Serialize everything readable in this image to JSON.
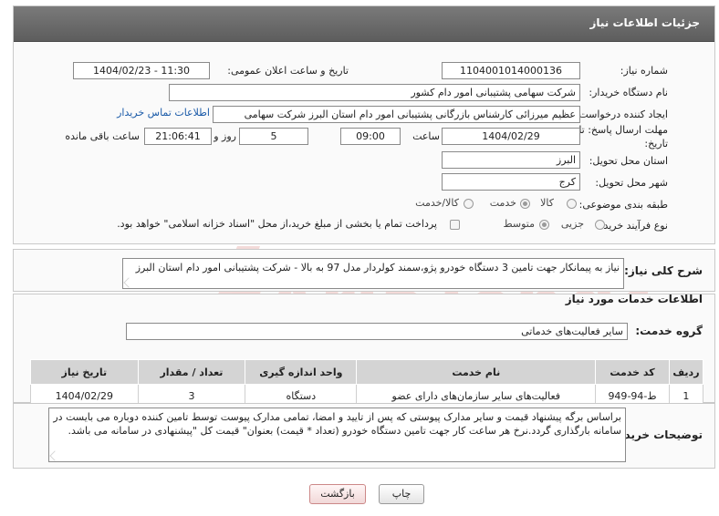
{
  "panel": {
    "title": "جزئیات اطلاعات نیاز"
  },
  "fields": {
    "need_number": {
      "label": "شماره نیاز:",
      "value": "1104001014000136"
    },
    "announce_datetime": {
      "label": "تاریخ و ساعت اعلان عمومی:",
      "value": "1404/02/23 - 11:30"
    },
    "buyer_org": {
      "label": "نام دستگاه خریدار:",
      "value": "شرکت سهامی پشتیبانی امور دام کشور"
    },
    "requester": {
      "label": "ایجاد کننده درخواست:",
      "value": "عظیم میرزائی کارشناس بازرگانی پشتیبانی امور دام استان البرز شرکت سهامی"
    },
    "buyer_contact_link": "اطلاعات تماس خریدار",
    "deadline": {
      "label_line1": "مهلت ارسال پاسخ: تا",
      "label_line2": "تاریخ:",
      "date": "1404/02/29",
      "time_label": "ساعت",
      "time": "09:00",
      "days": "5",
      "days_label": "روز و",
      "remaining": "21:06:41",
      "remaining_label": "ساعت باقی مانده"
    },
    "province": {
      "label": "استان محل تحویل:",
      "value": "البرز"
    },
    "city": {
      "label": "شهر محل تحویل:",
      "value": "کرج"
    },
    "category": {
      "label": "طبقه بندی موضوعی:",
      "options": [
        "کالا",
        "خدمت",
        "کالا/خدمت"
      ],
      "selected": "خدمت"
    },
    "process_type": {
      "label": "نوع فرآیند خرید :",
      "options": [
        "جزیی",
        "متوسط"
      ],
      "selected": "متوسط",
      "payment_note": "پرداخت تمام یا بخشی از مبلغ خرید،از محل \"اسناد خزانه اسلامی\" خواهد بود."
    }
  },
  "summary": {
    "label": "شرح کلی نیاز:",
    "text": "نیاز به پیمانکار جهت تامین 3 دستگاه خودرو پژو،سمند کولردار مدل 97 به بالا - شرکت پشتیبانی امور دام استان البرز"
  },
  "services_section": {
    "title": "اطلاعات خدمات مورد نیاز",
    "group_label": "گروه خدمت:",
    "group_value": "سایر فعالیت‌های خدماتی"
  },
  "table": {
    "headers": [
      "ردیف",
      "کد خدمت",
      "نام خدمت",
      "واحد اندازه گیری",
      "تعداد / مقدار",
      "تاریخ نیاز"
    ],
    "rows": [
      [
        "1",
        "ط-94-949",
        "فعالیت‌های سایر سازمان‌های دارای عضو",
        "دستگاه",
        "3",
        "1404/02/29"
      ]
    ]
  },
  "buyer_notes": {
    "label": "توضیحات خریدار:",
    "text": "براساس برگه پیشنهاد قیمت و سایر مدارک پیوستی که پس از تایید و امضا، تمامی مدارک پیوست توسط تامین کننده دوباره می بایست در سامانه بارگذاری گردد.نرخ هر ساعت کار جهت تامین دستگاه خودرو (تعداد * قیمت) بعنوان\" قیمت کل \"پیشنهادی در سامانه می باشد."
  },
  "buttons": {
    "print": "چاپ",
    "back": "بازگشت"
  },
  "watermark": {
    "brand": "AriaTender.neT"
  }
}
